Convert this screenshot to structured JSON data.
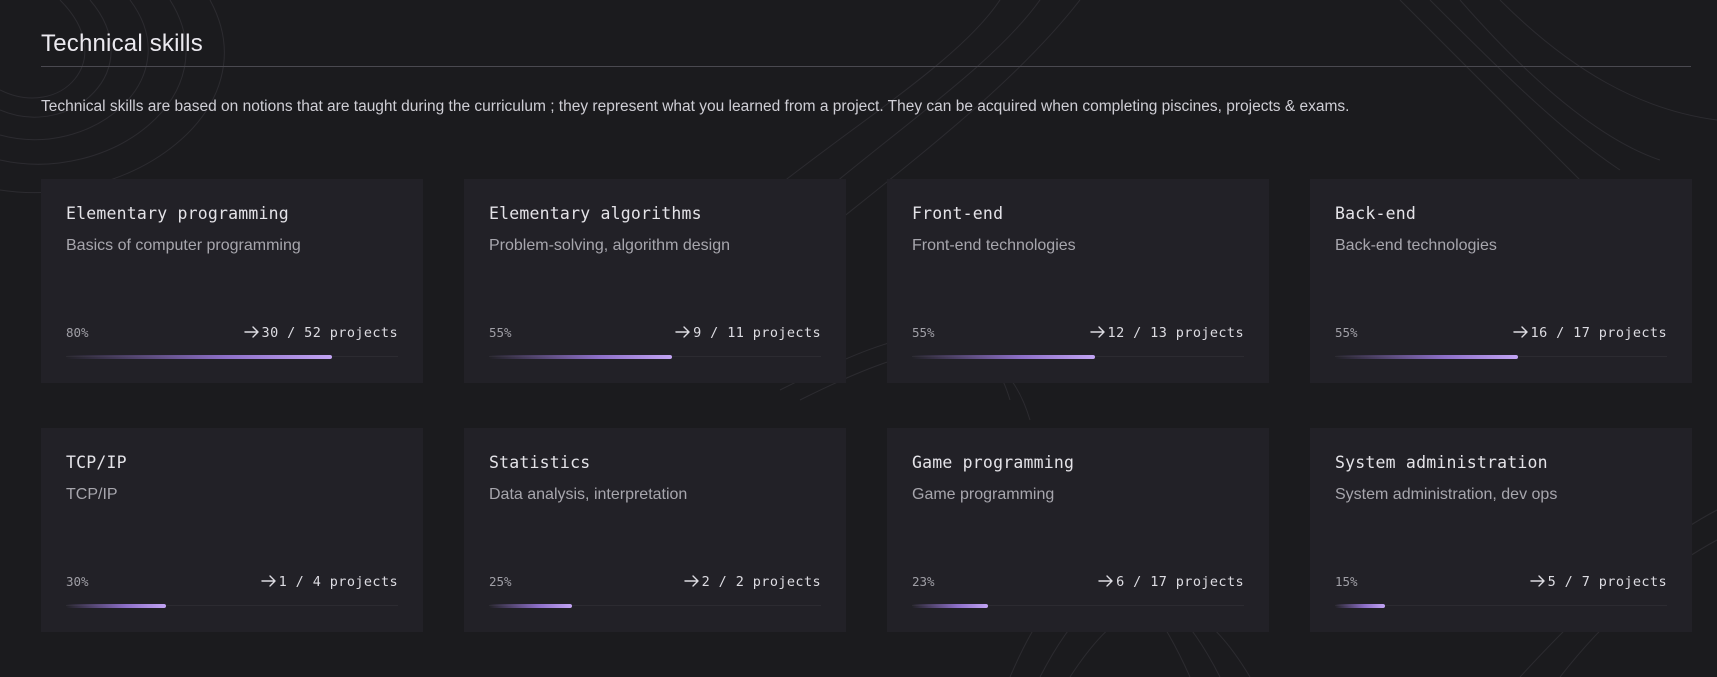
{
  "section": {
    "title": "Technical skills",
    "description": "Technical skills are based on notions that are taught during the curriculum ; they represent what you learned from a project. They can be acquired when completing piscines, projects & exams."
  },
  "colors": {
    "background": "#1b1b1e",
    "card": "#222127",
    "accent": "#c2a4f4"
  },
  "icons": {
    "projects_arrow": "arrow-right-icon"
  },
  "skills": [
    {
      "name": "Elementary programming",
      "subtitle": "Basics of computer programming",
      "percent_label": "80%",
      "projects_label": "30 / 52 projects",
      "progress": 0.8
    },
    {
      "name": "Elementary algorithms",
      "subtitle": "Problem-solving, algorithm design",
      "percent_label": "55%",
      "projects_label": "9 / 11 projects",
      "progress": 0.55
    },
    {
      "name": "Front-end",
      "subtitle": "Front-end technologies",
      "percent_label": "55%",
      "projects_label": "12 / 13 projects",
      "progress": 0.55
    },
    {
      "name": "Back-end",
      "subtitle": "Back-end technologies",
      "percent_label": "55%",
      "projects_label": "16 / 17 projects",
      "progress": 0.55
    },
    {
      "name": "TCP/IP",
      "subtitle": "TCP/IP",
      "percent_label": "30%",
      "projects_label": "1 / 4 projects",
      "progress": 0.3
    },
    {
      "name": "Statistics",
      "subtitle": "Data analysis, interpretation",
      "percent_label": "25%",
      "projects_label": "2 / 2 projects",
      "progress": 0.25
    },
    {
      "name": "Game programming",
      "subtitle": "Game programming",
      "percent_label": "23%",
      "projects_label": "6 / 17 projects",
      "progress": 0.23
    },
    {
      "name": "System administration",
      "subtitle": "System administration, dev ops",
      "percent_label": "15%",
      "projects_label": "5 / 7 projects",
      "progress": 0.15
    }
  ]
}
